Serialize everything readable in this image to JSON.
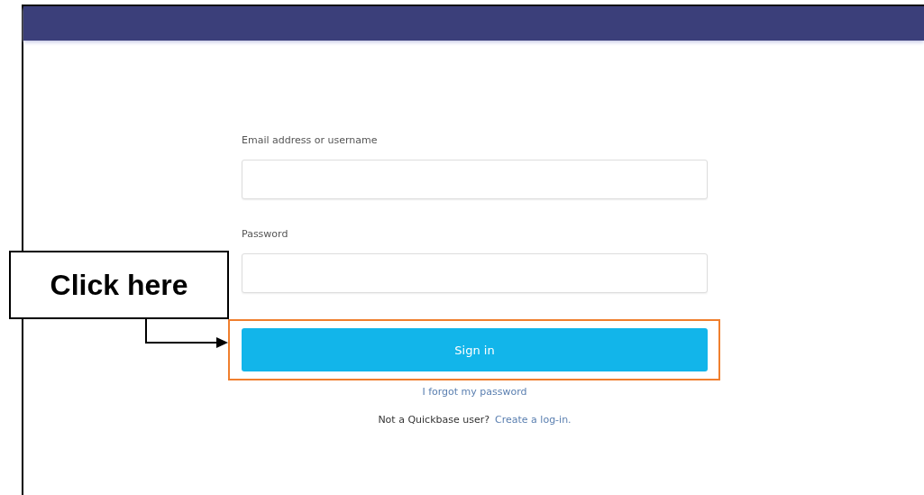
{
  "form": {
    "fields": [
      {
        "label": "Email address or username"
      },
      {
        "label": "Password"
      }
    ],
    "submit": {
      "label": "Sign in",
      "highlighted": true
    },
    "forgot_link": "I forgot my password",
    "signup_prompt": "Not a Quickbase user?",
    "signup_link": "Create a log-in."
  },
  "callout": {
    "text": "Click here"
  }
}
